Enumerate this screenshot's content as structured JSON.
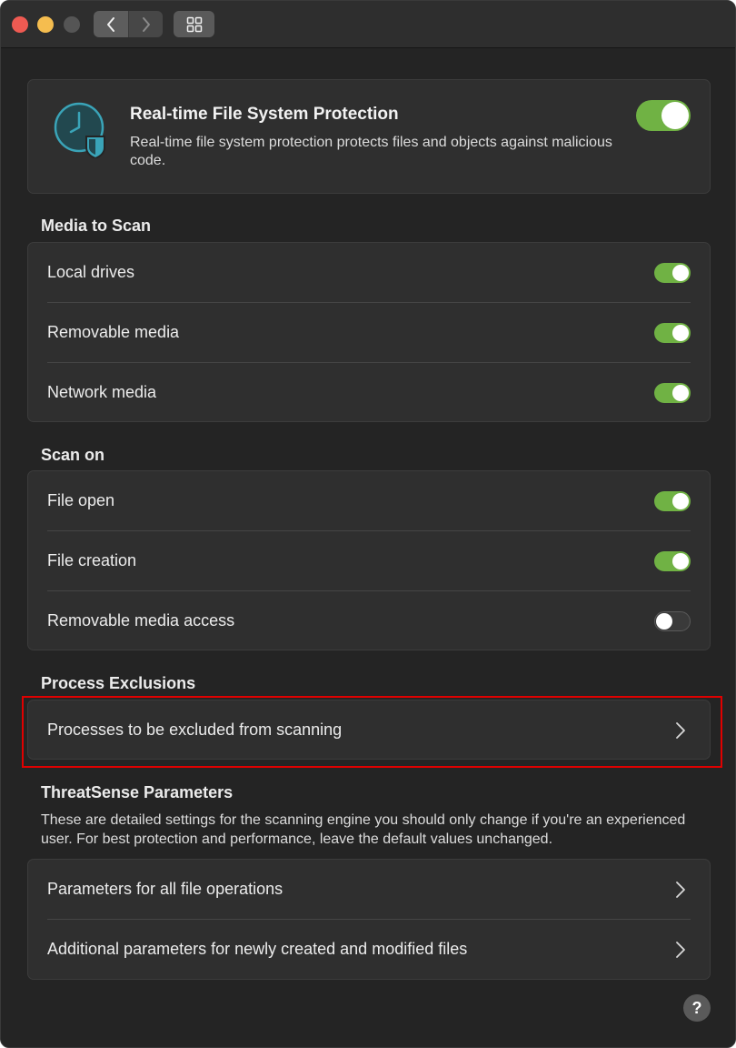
{
  "window": {
    "buttons": {
      "close": "close",
      "minimize": "minimize",
      "zoom": "zoom"
    },
    "toolbar": {
      "back_icon": "chevron-left-icon",
      "forward_icon": "chevron-right-icon",
      "grid_icon": "grid-icon"
    }
  },
  "hero": {
    "title": "Real-time File System Protection",
    "description": "Real-time file system protection protects files and objects against malicious code.",
    "icon": "clock-shield-icon",
    "enabled": true
  },
  "media_to_scan": {
    "heading": "Media to Scan",
    "items": [
      {
        "label": "Local drives",
        "enabled": true
      },
      {
        "label": "Removable media",
        "enabled": true
      },
      {
        "label": "Network media",
        "enabled": true
      }
    ]
  },
  "scan_on": {
    "heading": "Scan on",
    "items": [
      {
        "label": "File open",
        "enabled": true
      },
      {
        "label": "File creation",
        "enabled": true
      },
      {
        "label": "Removable media access",
        "enabled": false
      }
    ]
  },
  "process_exclusions": {
    "heading": "Process Exclusions",
    "items": [
      {
        "label": "Processes to be excluded from scanning"
      }
    ]
  },
  "threatsense": {
    "heading": "ThreatSense Parameters",
    "description": "These are detailed settings for the scanning engine you should only change if you're an experienced user. For best protection and performance, leave the default values unchanged.",
    "items": [
      {
        "label": "Parameters for all file operations"
      },
      {
        "label": "Additional parameters for newly created and modified files"
      }
    ]
  },
  "help": {
    "label": "?"
  },
  "colors": {
    "window_bg": "#242424",
    "card_bg": "#2f2f2f",
    "toggle_on": "#70b244",
    "highlight": "#e00000",
    "icon_teal": "#3aa4b8"
  }
}
